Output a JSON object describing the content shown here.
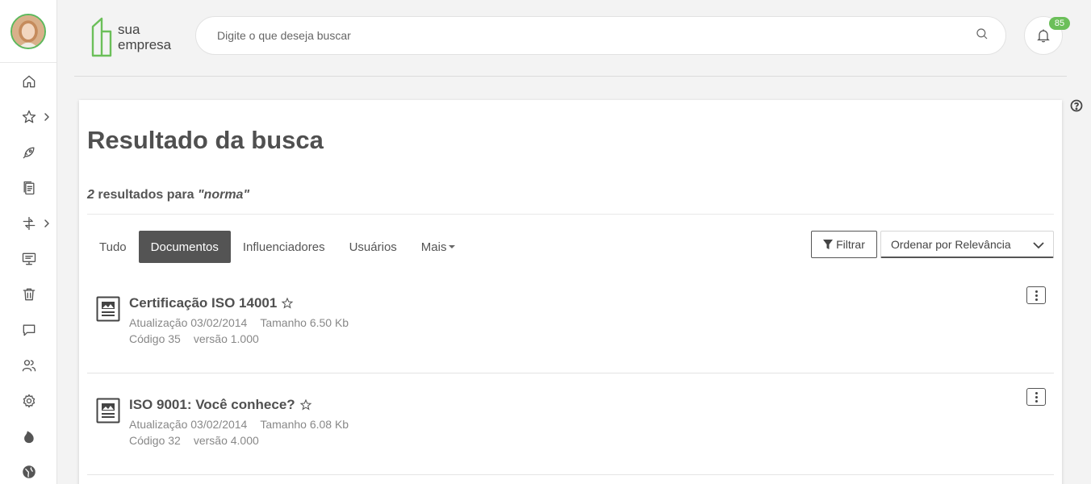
{
  "sidebar": {
    "avatar": "user-avatar",
    "items": [
      {
        "icon": "home-icon",
        "has_submenu": false
      },
      {
        "icon": "star-icon",
        "has_submenu": true
      },
      {
        "icon": "rocket-icon",
        "has_submenu": false
      },
      {
        "icon": "documents-icon",
        "has_submenu": false
      },
      {
        "icon": "workflow-icon",
        "has_submenu": true
      },
      {
        "icon": "presentation-icon",
        "has_submenu": false
      },
      {
        "icon": "trash-icon",
        "has_submenu": false
      },
      {
        "icon": "chat-icon",
        "has_submenu": false
      },
      {
        "icon": "users-icon",
        "has_submenu": false
      },
      {
        "icon": "gear-icon",
        "has_submenu": false
      },
      {
        "icon": "flame-icon",
        "has_submenu": false
      },
      {
        "icon": "globe-icon",
        "has_submenu": false
      }
    ]
  },
  "header": {
    "logo_line1": "sua",
    "logo_line2": "empresa",
    "search_placeholder": "Digite o que deseja buscar",
    "notification_count": "85"
  },
  "main": {
    "title": "Resultado da busca",
    "count": "2",
    "results_for": "resultados para",
    "query": "\"norma\"",
    "tabs": [
      {
        "label": "Tudo",
        "active": false
      },
      {
        "label": "Documentos",
        "active": true
      },
      {
        "label": "Influenciadores",
        "active": false
      },
      {
        "label": "Usuários",
        "active": false
      },
      {
        "label": "Mais",
        "active": false
      }
    ],
    "filter_label": "Filtrar",
    "order_label": "Ordenar por Relevância",
    "results": [
      {
        "title": "Certificação ISO 14001",
        "updated": "Atualização 03/02/2014",
        "size": "Tamanho 6.50 Kb",
        "code": "Código 35",
        "version": "versão 1.000"
      },
      {
        "title": "ISO 9001: Você conhece?",
        "updated": "Atualização 03/02/2014",
        "size": "Tamanho 6.08 Kb",
        "code": "Código 32",
        "version": "versão 4.000"
      }
    ]
  },
  "colors": {
    "accent_green": "#6bbf59",
    "active_tab": "#545454"
  }
}
